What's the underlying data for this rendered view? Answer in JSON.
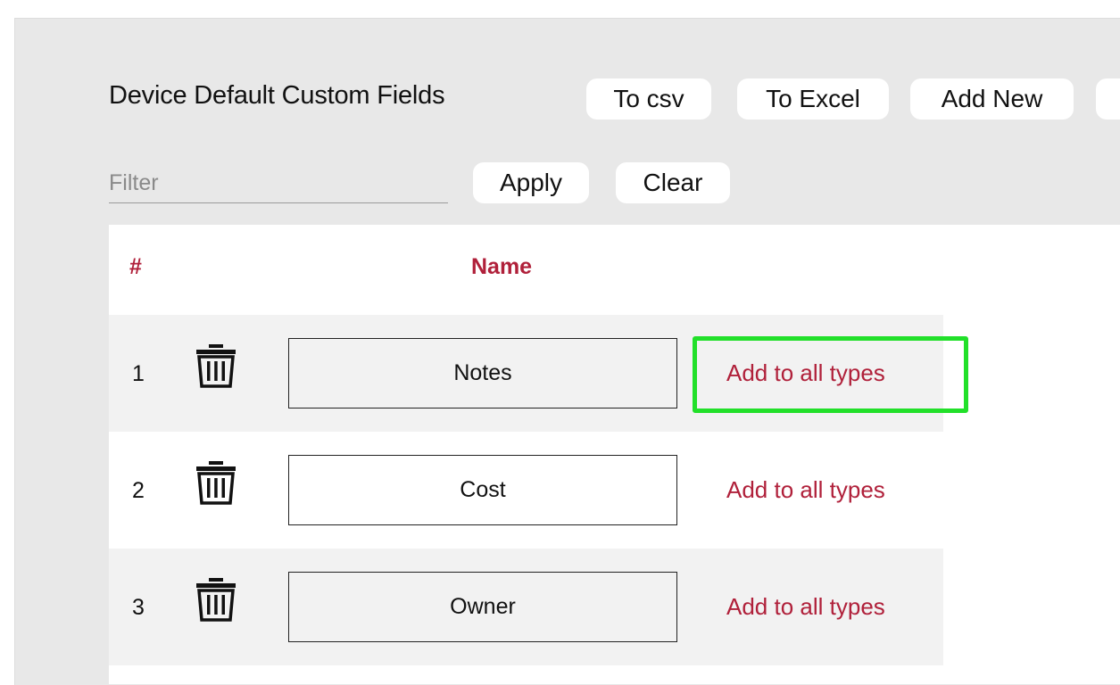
{
  "header": {
    "title": "Device Default Custom Fields",
    "buttons": [
      "To csv",
      "To Excel",
      "Add New"
    ]
  },
  "filter": {
    "placeholder": "Filter",
    "value": "",
    "apply_label": "Apply",
    "clear_label": "Clear"
  },
  "table": {
    "columns": {
      "number": "#",
      "name": "Name"
    },
    "rows": [
      {
        "number": "1",
        "name": "Notes",
        "action": "Add to all types"
      },
      {
        "number": "2",
        "name": "Cost",
        "action": "Add to all types"
      },
      {
        "number": "3",
        "name": "Owner",
        "action": "Add to all types"
      }
    ]
  },
  "icons": {
    "row_delete": "trash-icon"
  },
  "colors": {
    "accent": "#b0203a",
    "highlight": "#22e02a",
    "panel_bg": "#e8e8e8",
    "row_shade": "#f2f2f2"
  }
}
